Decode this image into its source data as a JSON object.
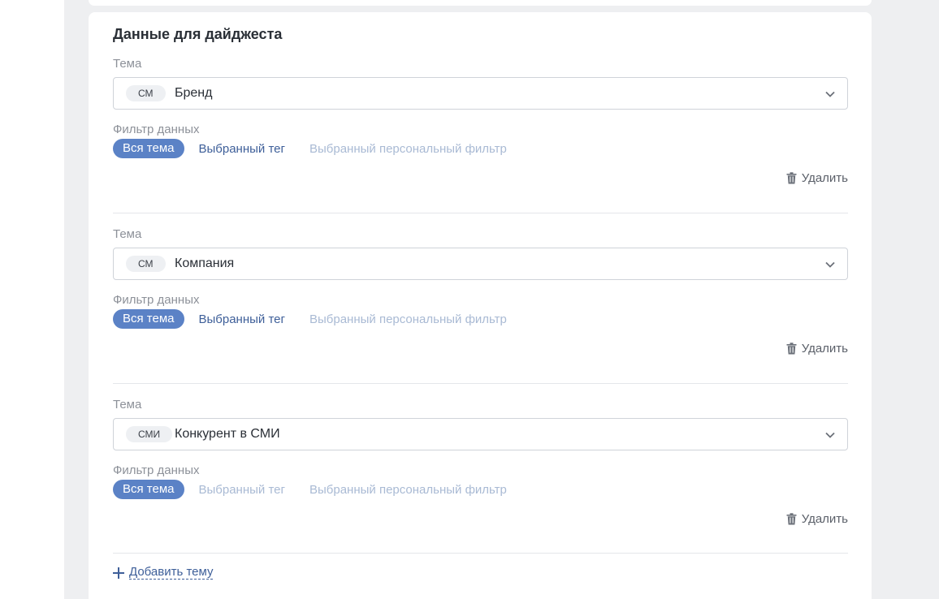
{
  "card": {
    "title": "Данные для дайджеста"
  },
  "sections": [
    {
      "theme_label": "Тема",
      "chip": "СМ",
      "value": "Бренд",
      "filter_label": "Фильтр данных",
      "filter_active": "Вся тема",
      "filter_tag": "Выбранный тег",
      "filter_personal": "Выбранный персональный фильтр",
      "delete": "Удалить"
    },
    {
      "theme_label": "Тема",
      "chip": "СМ",
      "value": "Компания",
      "filter_label": "Фильтр данных",
      "filter_active": "Вся тема",
      "filter_tag": "Выбранный тег",
      "filter_personal": "Выбранный персональный фильтр",
      "delete": "Удалить"
    },
    {
      "theme_label": "Тема",
      "chip": "СМИ",
      "value": "Конкурент в СМИ",
      "filter_label": "Фильтр данных",
      "filter_active": "Вся тема",
      "filter_tag": "Выбранный тег",
      "filter_personal": "Выбранный персональный фильтр",
      "delete": "Удалить"
    }
  ],
  "add_theme": "Добавить тему",
  "colors": {
    "accent": "#5b82c6",
    "link": "#3e5f99",
    "disabled_link": "#a9bad4",
    "background": "#eeeff1"
  },
  "icons": [
    "chevron-down-icon",
    "trash-icon",
    "plus-icon"
  ]
}
